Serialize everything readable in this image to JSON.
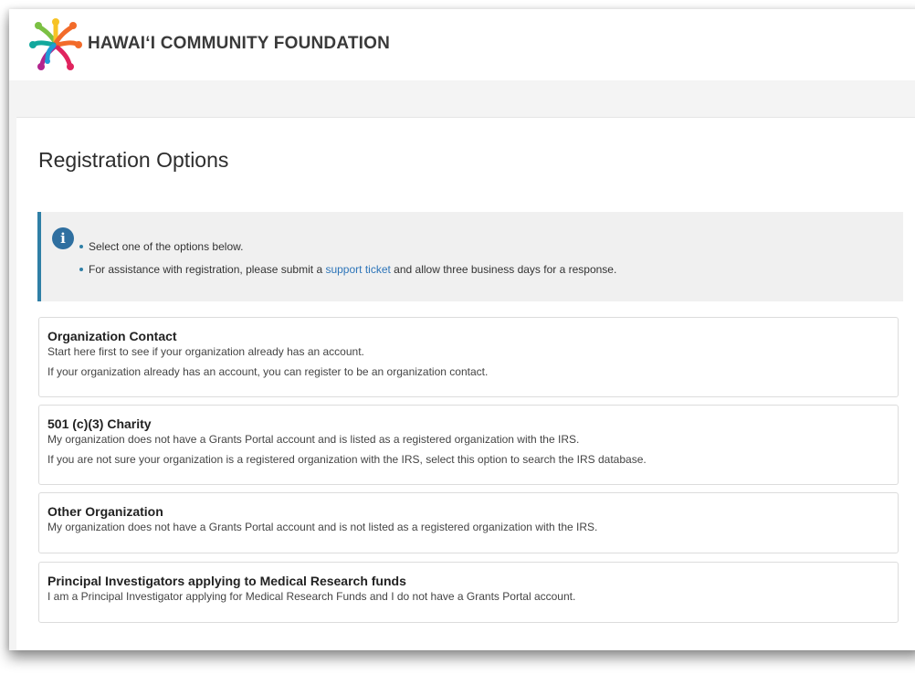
{
  "header": {
    "brand_name": "HAWAIʻI COMMUNITY FOUNDATION",
    "logo_icon": "hawaii-community-foundation-logo"
  },
  "main": {
    "title": "Registration Options",
    "info": {
      "icon": "info-icon",
      "bullet_1": "Select one of the options below.",
      "bullet_2_before": "For assistance with registration, please submit a ",
      "bullet_2_link": "support ticket",
      "bullet_2_after": " and allow three business days for a response."
    },
    "options": [
      {
        "title": "Organization Contact",
        "line1": "Start here first to see if your organization already has an account.",
        "line2": "If your organization already has an account, you can register to be an organization contact."
      },
      {
        "title": "501 (c)(3) Charity",
        "line1": "My organization does not have a Grants Portal account and is listed as a registered organization with the IRS.",
        "line2": "If you are not sure your organization is a registered organization with the IRS, select this option to search the IRS database."
      },
      {
        "title": "Other Organization",
        "line1": "My organization does not have a Grants Portal account and is not listed as a registered organization with the IRS."
      },
      {
        "title": "Principal Investigators applying to Medical Research funds",
        "line1": "I am a Principal Investigator applying for Medical Research Funds and I do not have a Grants Portal account."
      }
    ]
  },
  "colors": {
    "accent": "#2f7fa6",
    "link": "#2c74b8",
    "logo_green": "#7bc043",
    "logo_yellow": "#f7c325",
    "logo_orange": "#f26b2a",
    "logo_red": "#e0245e",
    "logo_magenta": "#b2258e",
    "logo_blue": "#1f9bd7",
    "logo_teal": "#12a89d"
  }
}
